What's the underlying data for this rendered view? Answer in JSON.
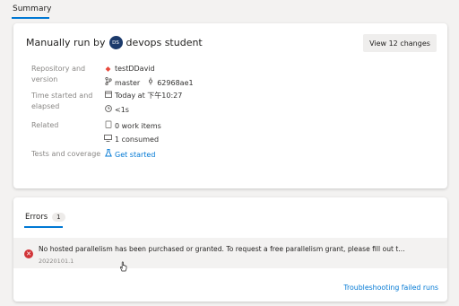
{
  "tabs": {
    "summary": "Summary"
  },
  "run": {
    "title_prefix": "Manually run by",
    "avatar_initials": "DS",
    "user": "devops student",
    "view_changes_button": "View 12 changes"
  },
  "details": {
    "repo_label": "Repository and version",
    "repo_name": "testDDavid",
    "branch": "master",
    "commit": "62968ae1",
    "time_label": "Time started and elapsed",
    "started": "Today at 下午10:27",
    "elapsed": "<1s",
    "related_label": "Related",
    "work_items": "0 work items",
    "consumed": "1 consumed",
    "tests_label": "Tests and coverage",
    "get_started": "Get started"
  },
  "errors": {
    "tab_label": "Errors",
    "count": "1",
    "message": "No hosted parallelism has been purchased or granted. To request a free parallelism grant, please fill out t...",
    "sub": "20220101.1",
    "troubleshooting_link": "Troubleshooting failed runs"
  },
  "colors": {
    "accent": "#0078d4",
    "error": "#d13438",
    "avatar": "#1b3a6b"
  },
  "icons": [
    "repo-icon",
    "branch-icon",
    "commit-icon",
    "calendar-icon",
    "clock-icon",
    "work-item-icon",
    "artifact-icon",
    "flask-icon",
    "error-icon",
    "cursor-icon"
  ]
}
